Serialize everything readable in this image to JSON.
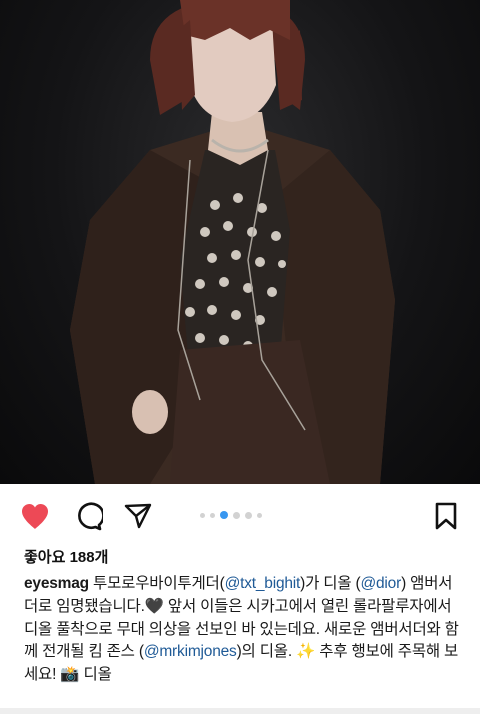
{
  "post": {
    "image": {
      "description_icon": "portrait-photo",
      "background_color": "#141416"
    },
    "actions": {
      "like_icon": "heart-filled-icon",
      "like_color": "#ed4956",
      "comment_icon": "comment-bubble-icon",
      "share_icon": "paper-plane-icon",
      "save_icon": "bookmark-icon"
    },
    "carousel": {
      "count": 6,
      "active_index": 2,
      "active_color": "#3897f0"
    },
    "likes_label": "좋아요 188개",
    "caption": {
      "username": "eyesmag",
      "seg1": " 투모로우바이투게더(",
      "mention1": "@txt_bighit",
      "seg2": ")가 디올 (",
      "mention2": "@dior",
      "seg3": ") 앰버서더로 임명됐습니다.🖤 앞서 이들은 시카고에서 열린 롤라팔루자에서 디올 풀착으로 무대 의상을 선보인 바 있는데요. 새로운 앰버서더와 함께 전개될 킴 존스 (",
      "mention3": "@mrkimjones",
      "seg4": ")의 디올. ✨ 추후 행보에 주목해 보세요! 📸 디올"
    }
  }
}
